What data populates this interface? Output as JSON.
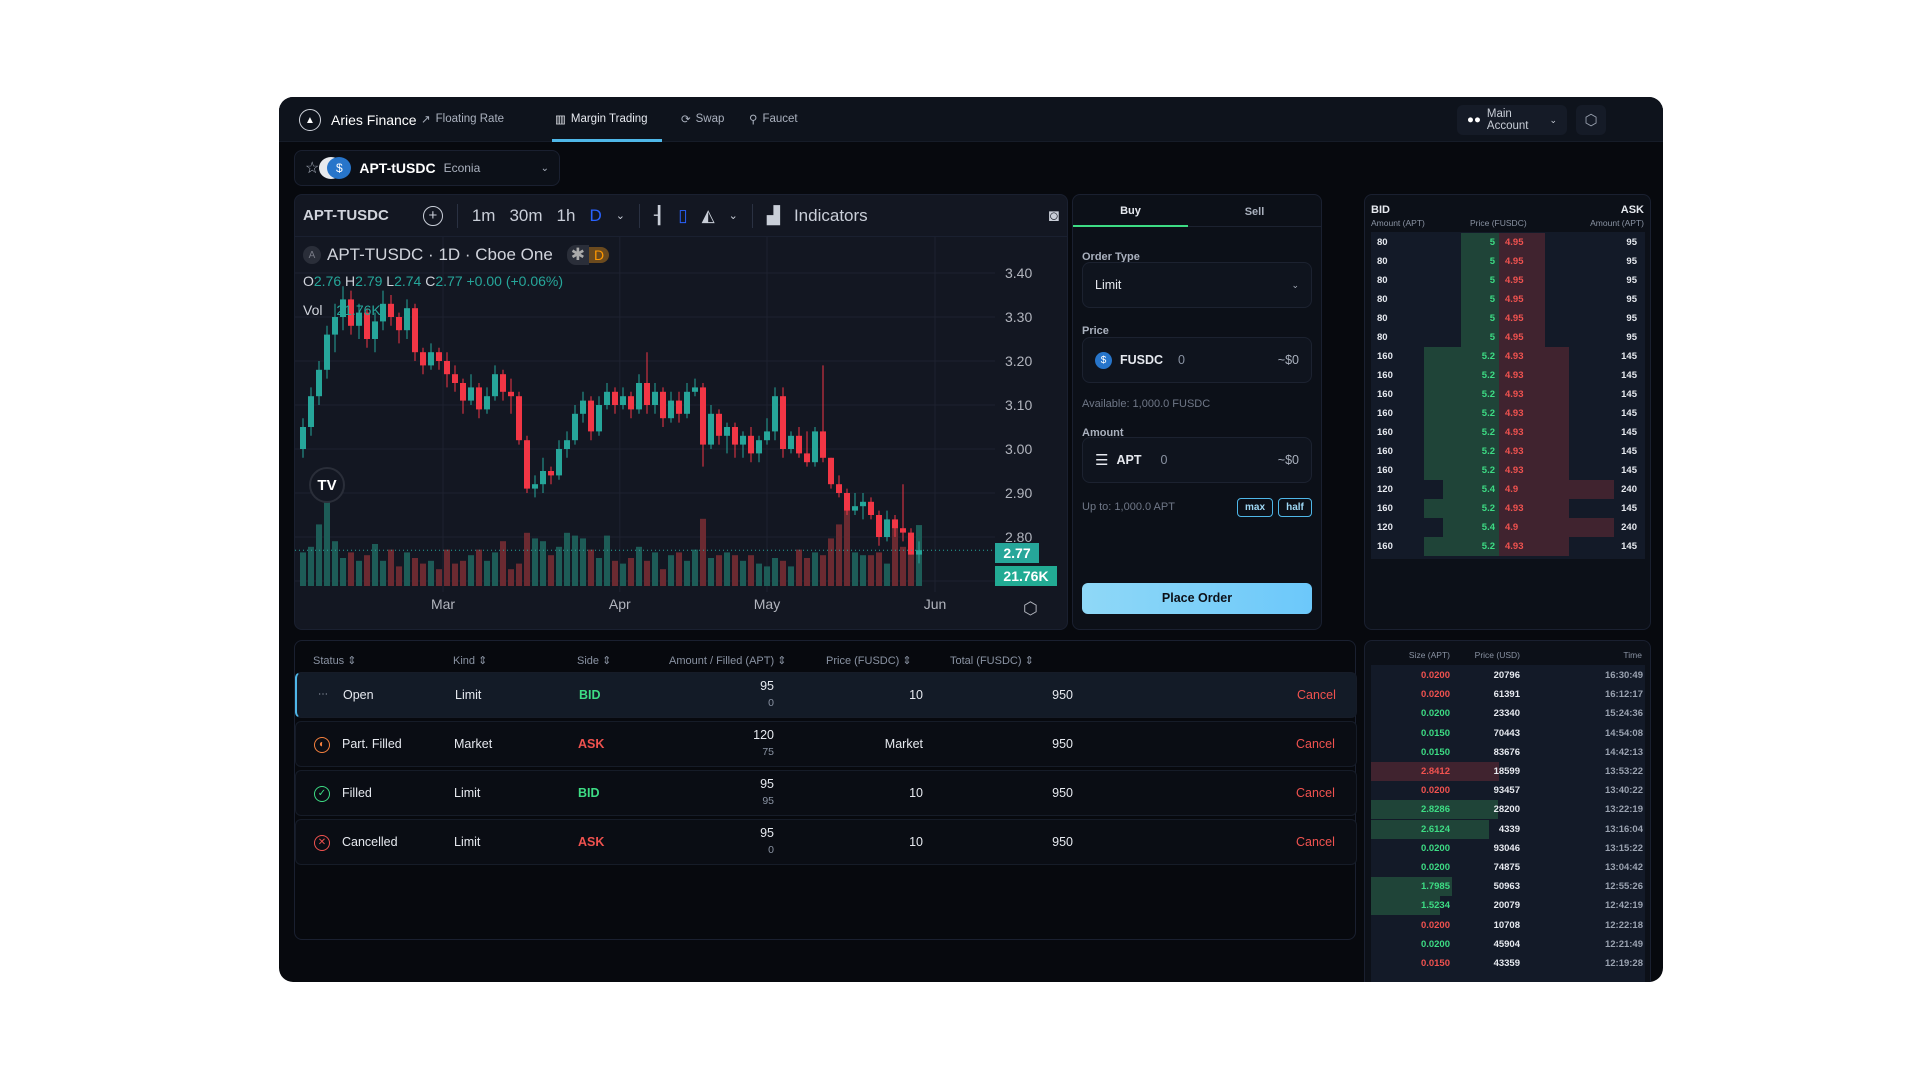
{
  "nav": {
    "brand": "Aries Finance",
    "links": [
      {
        "label": "Floating Rate",
        "icon": "trend-up-icon"
      },
      {
        "label": "Margin Trading",
        "icon": "bar-chart-icon",
        "active": true
      },
      {
        "label": "Swap",
        "icon": "refresh-icon"
      },
      {
        "label": "Faucet",
        "icon": "faucet-icon"
      }
    ],
    "account": "Main Account"
  },
  "market": {
    "pair": "APT-tUSDC",
    "venue": "Econia"
  },
  "chart": {
    "symbol": "APT-TUSDC",
    "intervals": [
      "1m",
      "30m",
      "1h",
      "D"
    ],
    "active_interval": "D",
    "indicators": "Indicators",
    "legend_title": "APT-TUSDC · 1D · Cboe One",
    "legend_badge": "D",
    "ohlc": {
      "o_label": "O",
      "o": "2.76",
      "h_label": "H",
      "h": "2.79",
      "l_label": "L",
      "l": "2.74",
      "c_label": "C",
      "c": "2.77",
      "change": "+0.00 (+0.06%)"
    },
    "vol_label": "Vol",
    "vol": "21.76K",
    "last_price": "2.77",
    "last_vol": "21.76K"
  },
  "chart_data": {
    "type": "candlestick",
    "title": "APT-TUSDC · 1D · Cboe One",
    "ylim": [
      2.66,
      3.45
    ],
    "y_ticks": [
      "3.40",
      "3.30",
      "3.20",
      "3.10",
      "3.00",
      "2.90",
      "2.80",
      "2.70"
    ],
    "x_ticks": [
      "Mar",
      "Apr",
      "May",
      "Jun"
    ],
    "grid": true,
    "colors": {
      "up": "#26a69a",
      "down": "#f23645"
    },
    "candles_ohlc_volK": [
      [
        3.0,
        3.07,
        2.98,
        3.05,
        12
      ],
      [
        3.05,
        3.14,
        3.03,
        3.12,
        14
      ],
      [
        3.12,
        3.2,
        3.1,
        3.18,
        22
      ],
      [
        3.18,
        3.28,
        3.16,
        3.26,
        30
      ],
      [
        3.26,
        3.33,
        3.22,
        3.3,
        16
      ],
      [
        3.3,
        3.37,
        3.27,
        3.34,
        10
      ],
      [
        3.34,
        3.36,
        3.26,
        3.28,
        12
      ],
      [
        3.28,
        3.33,
        3.25,
        3.31,
        9
      ],
      [
        3.31,
        3.32,
        3.23,
        3.25,
        11
      ],
      [
        3.25,
        3.31,
        3.22,
        3.29,
        15
      ],
      [
        3.29,
        3.36,
        3.27,
        3.33,
        9
      ],
      [
        3.33,
        3.35,
        3.28,
        3.3,
        13
      ],
      [
        3.3,
        3.31,
        3.24,
        3.27,
        7
      ],
      [
        3.27,
        3.34,
        3.25,
        3.32,
        12
      ],
      [
        3.32,
        3.33,
        3.2,
        3.22,
        10
      ],
      [
        3.22,
        3.23,
        3.17,
        3.19,
        8
      ],
      [
        3.19,
        3.24,
        3.18,
        3.22,
        9
      ],
      [
        3.22,
        3.23,
        3.18,
        3.2,
        6
      ],
      [
        3.2,
        3.22,
        3.14,
        3.17,
        13
      ],
      [
        3.17,
        3.19,
        3.13,
        3.15,
        8
      ],
      [
        3.15,
        3.16,
        3.08,
        3.11,
        9
      ],
      [
        3.11,
        3.17,
        3.1,
        3.14,
        11
      ],
      [
        3.14,
        3.15,
        3.07,
        3.09,
        13
      ],
      [
        3.09,
        3.14,
        3.08,
        3.12,
        9
      ],
      [
        3.12,
        3.19,
        3.11,
        3.17,
        12
      ],
      [
        3.17,
        3.18,
        3.11,
        3.13,
        16
      ],
      [
        3.13,
        3.16,
        3.08,
        3.12,
        6
      ],
      [
        3.12,
        3.13,
        3.01,
        3.02,
        8
      ],
      [
        3.02,
        3.03,
        2.9,
        2.91,
        19
      ],
      [
        2.91,
        2.94,
        2.89,
        2.92,
        17
      ],
      [
        2.92,
        2.98,
        2.9,
        2.95,
        16
      ],
      [
        2.95,
        2.96,
        2.92,
        2.94,
        11
      ],
      [
        2.94,
        3.02,
        2.93,
        3.0,
        14
      ],
      [
        3.0,
        3.04,
        2.98,
        3.02,
        19
      ],
      [
        3.02,
        3.1,
        3.01,
        3.08,
        18
      ],
      [
        3.08,
        3.13,
        3.06,
        3.11,
        17
      ],
      [
        3.11,
        3.12,
        3.02,
        3.04,
        13
      ],
      [
        3.04,
        3.12,
        3.03,
        3.1,
        10
      ],
      [
        3.1,
        3.15,
        3.09,
        3.13,
        18
      ],
      [
        3.13,
        3.14,
        3.08,
        3.1,
        9
      ],
      [
        3.1,
        3.14,
        3.09,
        3.12,
        8
      ],
      [
        3.12,
        3.13,
        3.07,
        3.09,
        10
      ],
      [
        3.09,
        3.17,
        3.08,
        3.15,
        14
      ],
      [
        3.15,
        3.22,
        3.08,
        3.1,
        9
      ],
      [
        3.1,
        3.15,
        3.08,
        3.13,
        12
      ],
      [
        3.13,
        3.14,
        3.05,
        3.07,
        6
      ],
      [
        3.07,
        3.13,
        3.06,
        3.11,
        11
      ],
      [
        3.11,
        3.13,
        3.06,
        3.08,
        12
      ],
      [
        3.08,
        3.15,
        3.07,
        3.13,
        9
      ],
      [
        3.13,
        3.16,
        3.12,
        3.14,
        13
      ],
      [
        3.14,
        3.15,
        2.96,
        3.01,
        24
      ],
      [
        3.01,
        3.1,
        3.0,
        3.08,
        10
      ],
      [
        3.08,
        3.09,
        3.01,
        3.03,
        11
      ],
      [
        3.03,
        3.06,
        2.99,
        3.05,
        12
      ],
      [
        3.05,
        3.06,
        2.98,
        3.01,
        11
      ],
      [
        3.01,
        3.04,
        2.98,
        3.03,
        9
      ],
      [
        3.03,
        3.05,
        2.97,
        2.99,
        11
      ],
      [
        2.99,
        3.03,
        2.97,
        3.02,
        8
      ],
      [
        3.02,
        3.07,
        3.01,
        3.04,
        7
      ],
      [
        3.04,
        3.14,
        3.02,
        3.12,
        10
      ],
      [
        3.12,
        3.14,
        2.98,
        3.0,
        9
      ],
      [
        3.0,
        3.04,
        2.99,
        3.03,
        7
      ],
      [
        3.03,
        3.05,
        2.98,
        2.99,
        13
      ],
      [
        2.99,
        3.04,
        2.96,
        2.97,
        10
      ],
      [
        2.97,
        3.05,
        2.96,
        3.04,
        12
      ],
      [
        3.04,
        3.19,
        2.97,
        2.98,
        11
      ],
      [
        2.98,
        2.98,
        2.91,
        2.92,
        17
      ],
      [
        2.92,
        2.94,
        2.89,
        2.9,
        22
      ],
      [
        2.9,
        2.91,
        2.85,
        2.86,
        28
      ],
      [
        2.86,
        2.9,
        2.85,
        2.87,
        12
      ],
      [
        2.87,
        2.9,
        2.84,
        2.88,
        11
      ],
      [
        2.88,
        2.89,
        2.84,
        2.85,
        11
      ],
      [
        2.85,
        2.86,
        2.78,
        2.8,
        12
      ],
      [
        2.8,
        2.86,
        2.79,
        2.84,
        8
      ],
      [
        2.84,
        2.85,
        2.8,
        2.82,
        22
      ],
      [
        2.82,
        2.92,
        2.79,
        2.81,
        14
      ],
      [
        2.81,
        2.82,
        2.76,
        2.76,
        15
      ],
      [
        2.76,
        2.79,
        2.74,
        2.77,
        21.76
      ]
    ]
  },
  "order_form": {
    "tabs": [
      "Buy",
      "Sell"
    ],
    "active_tab": "Buy",
    "order_type_label": "Order Type",
    "order_type": "Limit",
    "price_label": "Price",
    "price_token": "FUSDC",
    "price_value": "0",
    "price_usd": "~$0",
    "available": "Available:  1,000.0 FUSDC",
    "amount_label": "Amount",
    "amount_token": "APT",
    "amount_value": "0",
    "amount_usd": "~$0",
    "up_to": "Up to:  1,000.0 APT",
    "max": "max",
    "half": "half",
    "submit": "Place Order"
  },
  "orderbook": {
    "bid_title": "BID",
    "ask_title": "ASK",
    "bid_col": "Amount (APT)",
    "price_col": "Price (FUSDC)",
    "ask_col": "Amount (APT)",
    "rows": [
      [
        "80",
        "5",
        "4.95",
        "95"
      ],
      [
        "80",
        "5",
        "4.95",
        "95"
      ],
      [
        "80",
        "5",
        "4.95",
        "95"
      ],
      [
        "80",
        "5",
        "4.95",
        "95"
      ],
      [
        "80",
        "5",
        "4.95",
        "95"
      ],
      [
        "80",
        "5",
        "4.95",
        "95"
      ],
      [
        "160",
        "5.2",
        "4.93",
        "145"
      ],
      [
        "160",
        "5.2",
        "4.93",
        "145"
      ],
      [
        "160",
        "5.2",
        "4.93",
        "145"
      ],
      [
        "160",
        "5.2",
        "4.93",
        "145"
      ],
      [
        "160",
        "5.2",
        "4.93",
        "145"
      ],
      [
        "160",
        "5.2",
        "4.93",
        "145"
      ],
      [
        "160",
        "5.2",
        "4.93",
        "145"
      ],
      [
        "120",
        "5.4",
        "4.9",
        "240"
      ],
      [
        "160",
        "5.2",
        "4.93",
        "145"
      ],
      [
        "120",
        "5.4",
        "4.9",
        "240"
      ],
      [
        "160",
        "5.2",
        "4.93",
        "145"
      ]
    ]
  },
  "trades": {
    "cols": [
      "Size (APT)",
      "Price (USD)",
      "Time"
    ],
    "rows": [
      [
        "0.0200",
        "20796",
        "16:30:49",
        "sell"
      ],
      [
        "0.0200",
        "61391",
        "16:12:17",
        "sell"
      ],
      [
        "0.0200",
        "23340",
        "15:24:36",
        "buy"
      ],
      [
        "0.0150",
        "70443",
        "14:54:08",
        "buy"
      ],
      [
        "0.0150",
        "83676",
        "14:42:13",
        "buy"
      ],
      [
        "2.8412",
        "18599",
        "13:53:22",
        "sell"
      ],
      [
        "0.0200",
        "93457",
        "13:40:22",
        "sell"
      ],
      [
        "2.8286",
        "28200",
        "13:22:19",
        "buy"
      ],
      [
        "2.6124",
        "4339",
        "13:16:04",
        "buy"
      ],
      [
        "0.0200",
        "93046",
        "13:15:22",
        "buy"
      ],
      [
        "0.0200",
        "74875",
        "13:04:42",
        "buy"
      ],
      [
        "1.7985",
        "50963",
        "12:55:26",
        "buy"
      ],
      [
        "1.5234",
        "20079",
        "12:42:19",
        "buy"
      ],
      [
        "0.0200",
        "10708",
        "12:22:18",
        "sell"
      ],
      [
        "0.0200",
        "45904",
        "12:21:49",
        "buy"
      ],
      [
        "0.0150",
        "43359",
        "12:19:28",
        "sell"
      ]
    ]
  },
  "orders": {
    "cols": [
      "Status",
      "Kind",
      "Side",
      "Amount / Filled (APT)",
      "Price (FUSDC)",
      "Total (FUSDC)"
    ],
    "cancel": "Cancel",
    "rows": [
      {
        "status": "Open",
        "icon": "dots-icon",
        "kind": "Limit",
        "side": "BID",
        "amount": "95",
        "filled": "0",
        "price": "10",
        "total": "950"
      },
      {
        "status": "Part. Filled",
        "icon": "half-circle-icon",
        "kind": "Market",
        "side": "ASK",
        "amount": "120",
        "filled": "75",
        "price": "Market",
        "total": "950"
      },
      {
        "status": "Filled",
        "icon": "check-circle-icon",
        "kind": "Limit",
        "side": "BID",
        "amount": "95",
        "filled": "95",
        "price": "10",
        "total": "950"
      },
      {
        "status": "Cancelled",
        "icon": "x-circle-icon",
        "kind": "Limit",
        "side": "ASK",
        "amount": "95",
        "filled": "0",
        "price": "10",
        "total": "950"
      }
    ]
  },
  "colors": {
    "bid": "#3ddc84",
    "ask": "#f0524f",
    "accent": "#4fb7e8",
    "button": "#7dd3fc"
  }
}
